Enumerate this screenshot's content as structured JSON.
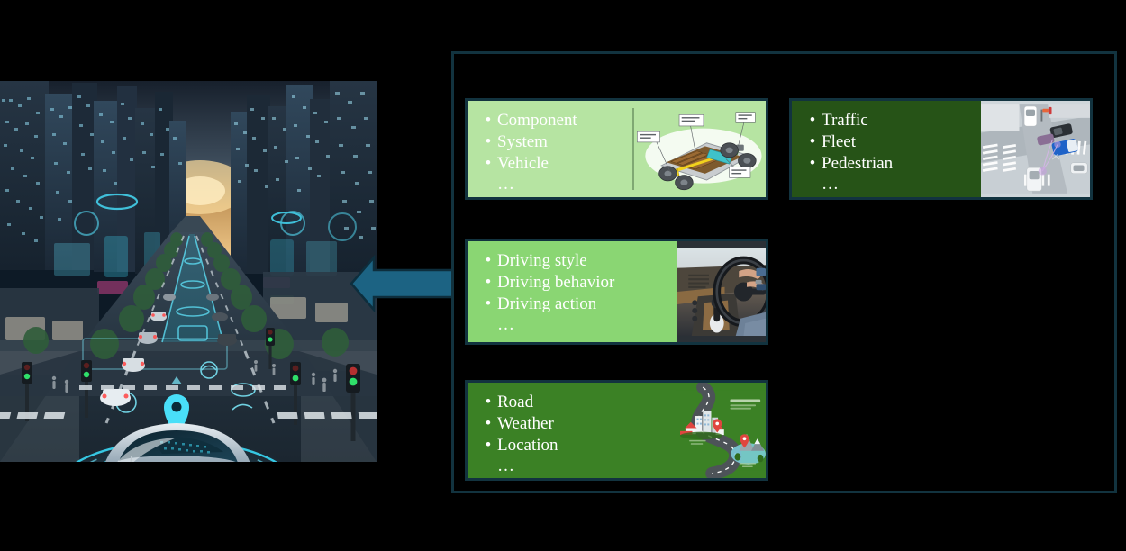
{
  "figure": {
    "title": "",
    "arrow": {
      "name": "left-pointing-block-arrow",
      "color": "#1c6383",
      "direction": "left"
    },
    "outer_container": {
      "border_color": "#12333f",
      "background": "#000000"
    }
  },
  "scene_image": {
    "name": "smart-city-street-scene",
    "caption": "Futuristic smart-city avenue at dusk with connected autonomous vehicle, glowing HUD rings, traffic lights, pedestrians and skyscrapers"
  },
  "cards": [
    {
      "id": "card1",
      "name": "component-system-vehicle-card",
      "bullet_char": "•",
      "items": [
        "Component",
        "System",
        "Vehicle"
      ],
      "ellipsis": "…",
      "bg_color": "#b6e4a2",
      "text_color": "#ffffff",
      "border_color": "#12333f",
      "image": {
        "name": "fuel-cell-vehicle-chassis-diagram",
        "caption": "Cut-away fuel-cell electric vehicle chassis diagram",
        "labels": [
          "Hydrogen storage tank",
          "Electric motor",
          "High output battery",
          "Fuel cell stack"
        ]
      }
    },
    {
      "id": "card2",
      "name": "traffic-fleet-pedestrian-card",
      "bullet_char": "•",
      "items": [
        "Traffic",
        "Fleet",
        "Pedestrian"
      ],
      "ellipsis": "…",
      "bg_color": "#265317",
      "text_color": "#ffffff",
      "border_color": "#12333f",
      "image": {
        "name": "v2x-intersection-aerial-view",
        "caption": "Aerial view of a road intersection with vehicles, crosswalks and V2X connectivity links"
      }
    },
    {
      "id": "card3",
      "name": "driving-style-behavior-action-card",
      "bullet_char": "•",
      "items": [
        "Driving style",
        "Driving behavior",
        "Driving action"
      ],
      "ellipsis": "…",
      "bg_color": "#8ad673",
      "text_color": "#ffffff",
      "border_color": "#12333f",
      "image": {
        "name": "driver-hands-on-steering-wheel",
        "caption": "Interior photo of a driver's hands on the steering wheel with gear shifter and dashboard"
      }
    },
    {
      "id": "card4",
      "name": "road-weather-location-card",
      "bullet_char": "•",
      "items": [
        "Road",
        "Weather",
        "Location"
      ],
      "ellipsis": "…",
      "bg_color": "#3b8125",
      "text_color": "#ffffff",
      "border_color": "#12333f",
      "image": {
        "name": "road-infographic-illustration",
        "caption": "Winding road infographic illustration with map pins, buildings and mountains",
        "labels": [
          "Road Infographic"
        ]
      }
    }
  ]
}
